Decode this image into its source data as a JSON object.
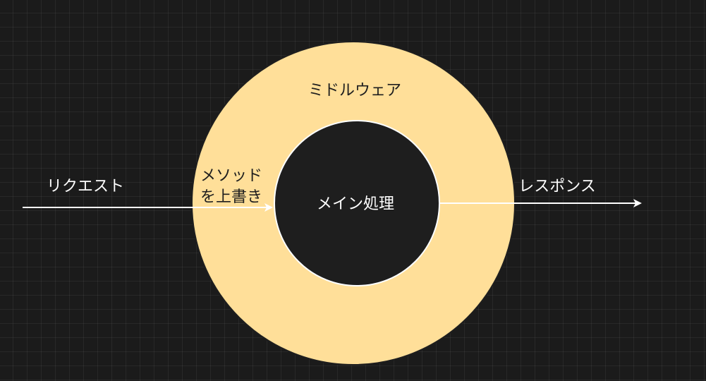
{
  "diagram": {
    "outer_label": "ミドルウェア",
    "inner_label": "メイン処理",
    "request_label": "リクエスト",
    "override_label_line1": "メソッド",
    "override_label_line2": "を上書き",
    "response_label": "レスポンス"
  },
  "colors": {
    "background": "#1b1b1b",
    "outer_ring_fill": "#ffdf99",
    "inner_circle_fill": "#1e1e1e",
    "stroke": "#ffffff",
    "dark_text": "#1e1e1e",
    "light_text": "#ffffff"
  }
}
